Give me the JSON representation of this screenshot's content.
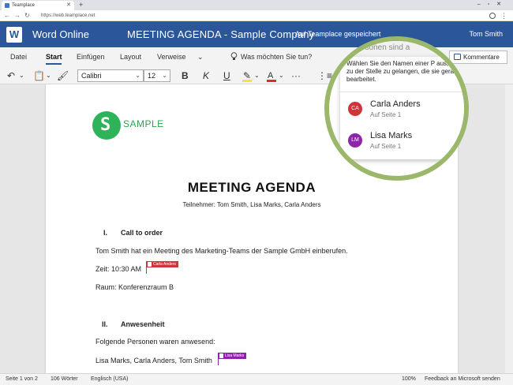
{
  "browser": {
    "tab_title": "Teamplace",
    "url": "https://web.teamplace.net"
  },
  "word": {
    "app_name": "Word Online",
    "doc_title": "MEETING AGENDA - Sample Company",
    "doc_title_sep": "-",
    "saved_status": "Auf Teamplace gespeichert",
    "user": "Tom Smith",
    "accent": "#2b579a"
  },
  "ribbon": {
    "tabs": [
      "Datei",
      "Start",
      "Einfügen",
      "Layout",
      "Verweise"
    ],
    "active_tab": "Start",
    "tell_me": "Was möchten Sie tun?",
    "comments": "Kommentare",
    "font": "Calibri",
    "size": "12",
    "bold": "B",
    "italic": "K",
    "underline": "U"
  },
  "document": {
    "logo_text": "SAMPLE",
    "title": "MEETING AGENDA",
    "participants": "Teilnehmer: Tom Smith, Lisa Marks, Carla Anders",
    "s1_num": "I.",
    "s1_heading": "Call to order",
    "s1_p1": "Tom Smith hat ein Meeting des Marketing-Teams der Sample GmbH einberufen.",
    "s1_p2": "Zeit: 10:30 AM",
    "s1_p3": "Raum: Konferenzraum B",
    "s2_num": "II.",
    "s2_heading": "Anwesenheit",
    "s2_p1": "Folgende Personen waren anwesend:",
    "s2_p2": "Lisa Marks, Carla Anders, Tom Smith"
  },
  "cursors": {
    "carla": {
      "name": "Carla Anders",
      "color": "#d13438"
    },
    "lisa": {
      "name": "Lisa Marks",
      "color": "#8e24aa"
    }
  },
  "presence": {
    "header_hint": "Personen sind a",
    "help": "Wählen Sie den Namen einer P aus, um zu der Stelle zu gelangen, die sie gerade bearbeitet.",
    "users": [
      {
        "initials": "CA",
        "name": "Carla Anders",
        "page": "Auf Seite 1",
        "color": "#d13438"
      },
      {
        "initials": "LM",
        "name": "Lisa Marks",
        "page": "Auf Seite 1",
        "color": "#8e24aa"
      }
    ]
  },
  "status": {
    "page": "Seite 1 von 2",
    "words": "106 Wörter",
    "language": "Englisch (USA)",
    "zoom": "100%",
    "feedback": "Feedback an Microsoft senden"
  }
}
